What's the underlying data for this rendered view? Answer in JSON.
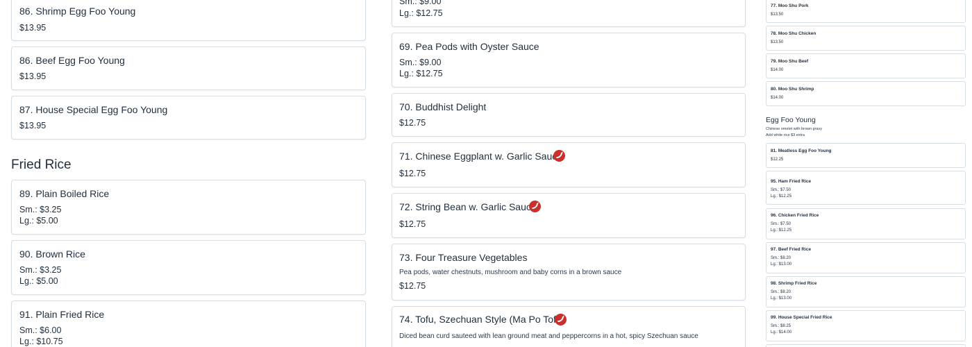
{
  "left_column": {
    "items": [
      {
        "title": "86. Shrimp Egg Foo Young",
        "price": "$13.95"
      },
      {
        "title": "86. Beef Egg Foo Young",
        "price": "$13.95"
      },
      {
        "title": "87. House Special Egg Foo Young",
        "price": "$13.95"
      }
    ],
    "section_fried_rice": "Fried Rice",
    "fried_rice_items": [
      {
        "title": "89. Plain Boiled Rice",
        "sm": "Sm.: $3.25",
        "lg": "Lg.: $5.00"
      },
      {
        "title": "90. Brown Rice",
        "sm": "Sm.: $3.25",
        "lg": "Lg.: $5.00"
      },
      {
        "title": "91. Plain Fried Rice",
        "sm": "Sm.: $6.00",
        "lg": "Lg.: $10.75"
      }
    ]
  },
  "middle_column": {
    "top_partial": {
      "sm": "Sm.: $9.00",
      "lg": "Lg.: $12.75"
    },
    "items": [
      {
        "title": "69. Pea Pods with Oyster Sauce",
        "sm": "Sm.: $9.00",
        "lg": "Lg.: $12.75"
      },
      {
        "title": "70. Buddhist Delight",
        "price": "$12.75"
      },
      {
        "title": "71. Chinese Eggplant w. Garlic Sauce",
        "price": "$12.75",
        "spicy": true
      },
      {
        "title": "72. String Bean w. Garlic Sauce",
        "price": "$12.75",
        "spicy": true
      },
      {
        "title": "73. Four Treasure Vegetables",
        "desc": "Pea pods, water chestnuts, mushroom and baby corns in a brown sauce",
        "price": "$12.75"
      },
      {
        "title": "74. Tofu, Szechuan Style (Ma Po Tofu)",
        "desc": "Diced bean curd sauteed with lean ground meat and peppercorns in a hot, spicy Szechuan sauce",
        "spicy": true
      }
    ]
  },
  "right_column": {
    "moo_shu": [
      {
        "title": "77. Moo Shu Pork",
        "price": "$13.50"
      },
      {
        "title": "78. Moo Shu Chicken",
        "price": "$13.50"
      },
      {
        "title": "79. Moo Shu Beef",
        "price": "$14.00"
      },
      {
        "title": "80. Moo Shu Shrimp",
        "price": "$14.00"
      }
    ],
    "egg_foo_young_heading": "Egg Foo Young",
    "egg_foo_young_desc1": "Chinese omelet with brown gravy",
    "egg_foo_young_desc2": "Add white rice $3 extra",
    "egg_items": [
      {
        "title": "81. Meatless Egg Foo Young",
        "price": "$12.25"
      }
    ],
    "fried_rice": [
      {
        "title": "95. Ham Fried Rice",
        "sm": "Sm.: $7.50",
        "lg": "Lg.: $12.25"
      },
      {
        "title": "96. Chicken Fried Rice",
        "sm": "Sm.: $7.50",
        "lg": "Lg.: $12.25"
      },
      {
        "title": "97. Beef Fried Rice",
        "sm": "Sm.: $8.20",
        "lg": "Lg.: $13.00"
      },
      {
        "title": "98. Shrimp Fried Rice",
        "sm": "Sm.: $8.20",
        "lg": "Lg.: $13.00"
      },
      {
        "title": "99. House Special Fried Rice",
        "sm": "Sm.: $8.25",
        "lg": "Lg.: $14.00"
      }
    ]
  },
  "colors": {
    "spicy": "#c8312b",
    "border": "#d6dde3",
    "text": "#1f2d3d"
  },
  "icons": {
    "spicy": "chili-pepper-icon"
  }
}
